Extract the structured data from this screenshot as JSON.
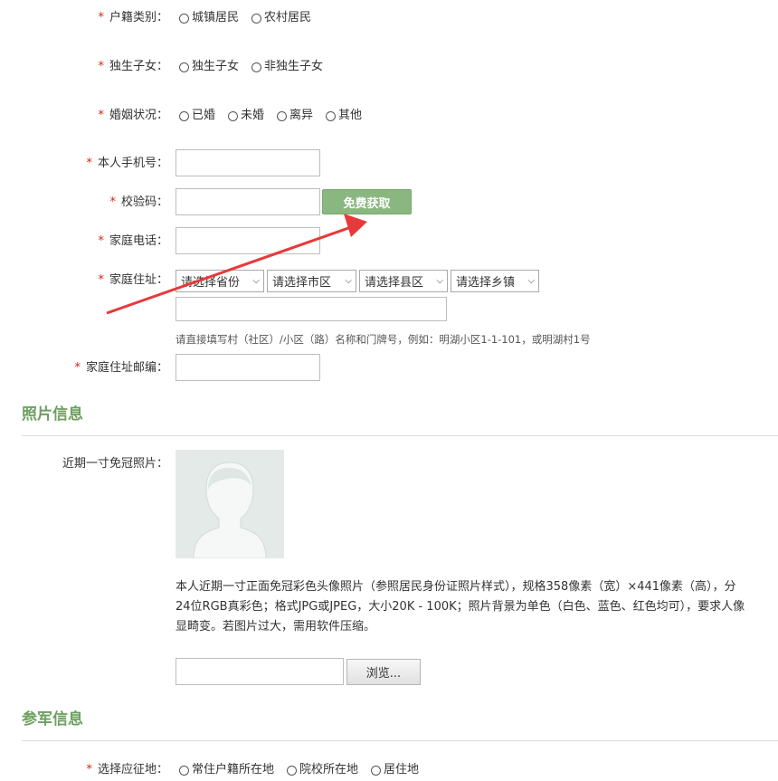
{
  "hukou": {
    "label": "户籍类别：",
    "options": [
      "城镇居民",
      "农村居民"
    ]
  },
  "only_child": {
    "label": "独生子女：",
    "options": [
      "独生子女",
      "非独生子女"
    ]
  },
  "marital": {
    "label": "婚姻状况：",
    "options": [
      "已婚",
      "未婚",
      "离异",
      "其他"
    ]
  },
  "mobile": {
    "label": "本人手机号：",
    "value": ""
  },
  "verify": {
    "label": "校验码：",
    "value": "",
    "button": "免费获取"
  },
  "home_phone": {
    "label": "家庭电话：",
    "value": ""
  },
  "address": {
    "label": "家庭住址：",
    "selects": [
      "请选择省份",
      "请选择市区",
      "请选择县区",
      "请选择乡镇"
    ],
    "detail_value": "",
    "hint": "请直接填写村（社区）/小区（路）名称和门牌号，例如：明湖小区1-1-101，或明湖村1号"
  },
  "postcode": {
    "label": "家庭住址邮编：",
    "value": ""
  },
  "photo_section": {
    "title": "照片信息",
    "photo_label": "近期一寸免冠照片：",
    "desc_lines": [
      "本人近期一寸正面免冠彩色头像照片（参照居民身份证照片样式），规格358像素（宽）×441像素（高），分",
      "24位RGB真彩色；格式JPG或JPEG，大小20K - 100K；照片背景为单色（白色、蓝色、红色均可），要求人像",
      "显畸变。若图片过大，需用软件压缩。"
    ],
    "file_value": "",
    "browse_label": "浏览..."
  },
  "military_section": {
    "title": "参军信息",
    "conscription": {
      "label": "选择应征地：",
      "options": [
        "常住户籍所在地",
        "院校所在地",
        "居住地"
      ]
    }
  },
  "colors": {
    "accent_green": "#6da05f",
    "button_green": "#8ab77f",
    "required_star": "#d9230f",
    "annotation_arrow": "#e8393a"
  },
  "icons": {
    "radio": "radio-unchecked",
    "select": "chevron-down",
    "photo": "avatar-placeholder",
    "arrow": "red-annotation-arrow"
  }
}
